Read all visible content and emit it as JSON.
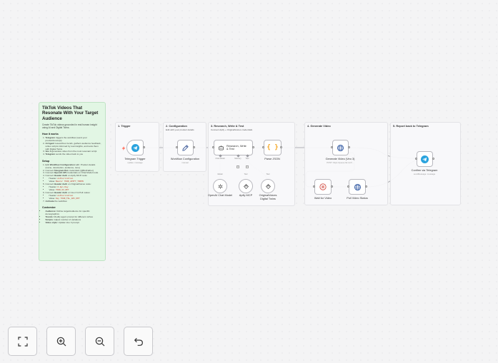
{
  "sticky": {
    "title": "TikTok Videos That Resonate With Your Target Audience",
    "description": "Create TikTok videos grounded in real human insight using AI and Digital Twins.",
    "how_heading": "How it works",
    "how_steps": [
      [
        "Telegram",
        " triggers the workflow (send your product/concept)"
      ],
      [
        "AI Agent",
        " researches trends, gathers audience feedback, writes scripts informed by real insights, and tests them with Digital Twins"
      ],
      [
        "Veo 3",
        " generates video from the most resonant script"
      ],
      [
        "Telegram",
        " sends the video back to you"
      ]
    ],
    "setup_heading": "Setup",
    "setup_steps": [
      {
        "pre": "Edit ",
        "bold": "Workflow Configuration",
        "post": " with: Product details (name, description, audience, tone)",
        "sub": []
      },
      {
        "pre": "Connect ",
        "bold": "Telegram Bot",
        "post": " credentials (@BotFather)",
        "sub": []
      },
      {
        "pre": "Connect ",
        "bold": "OpenAI API",
        "post": " credentials on Chat Model node",
        "sub": []
      },
      {
        "pre": "Connect ",
        "bold": "Header Auth",
        "post": " on Apify MCP node:",
        "sub": [
          [
            "Header: ",
            "Authorization"
          ],
          [
            "Value: ",
            "Bearer YOUR_APIFY_TOKEN"
          ]
        ]
      },
      {
        "pre": "Connect ",
        "bold": "Header Auth",
        "post": " on OriginalVoices node:",
        "sub": [
          [
            "Header: ",
            "X-Api-Key"
          ],
          [
            "Value: ",
            "YOUR_OV_KEY"
          ]
        ]
      },
      {
        "pre": "Connect ",
        "bold": "Header Auth",
        "post": " on Veo 3 & Poll nodes:",
        "sub": [
          [
            "Header: ",
            "Authorization"
          ],
          [
            "Value: ",
            "Key YOUR_FAL_API_KEY"
          ]
        ]
      },
      {
        "pre": "",
        "bold": "Activate",
        "post": " the workflow",
        "sub": []
      }
    ],
    "custom_heading": "Customize",
    "custom_items": [
      [
        "Audience:",
        " Refine targetAudience for specific demographics"
      ],
      [
        "Trends:",
        " Modify agent prompt for different niches"
      ],
      [
        "Scripts:",
        " Adjust number of variations"
      ],
      [
        "Video style:",
        " Update Veo 3 prompt"
      ]
    ]
  },
  "groups": {
    "trigger": {
      "title": "1. Trigger",
      "sub": ""
    },
    "config": {
      "title": "2. Configuration",
      "sub": "Edit with your product details"
    },
    "research": {
      "title": "3. Research, Write & Test",
      "sub": "Connect Apify + OriginalVoices credentials"
    },
    "video": {
      "title": "4. Generate Video",
      "sub": ""
    },
    "report": {
      "title": "5. Report back to Telegram",
      "sub": ""
    }
  },
  "nodes": {
    "telegram_trigger": {
      "label": "Telegram Trigger",
      "sub": "update: message"
    },
    "workflow_config": {
      "label": "Workflow Configuration",
      "sub": "manual"
    },
    "agent": {
      "label": "Research, Write & Test"
    },
    "parse_json": {
      "label": "Parse JSON"
    },
    "generate_video": {
      "label": "Generate Video (Veo 3)",
      "sub": "POST: https://queue.fal.run/f..."
    },
    "confirm_telegram": {
      "label": "Confirm via Telegram",
      "sub": "sendMessage: message"
    },
    "wait_video": {
      "label": "Wait for Video"
    },
    "poll_video": {
      "label": "Poll Video Status"
    },
    "openai_model": {
      "label": "OpenAI Chat Model"
    },
    "apify_mcp": {
      "label": "Apify MCP"
    },
    "originalvoices": {
      "label": "OriginalVoices Digital Twins"
    }
  },
  "ports": {
    "chat_model": "Chat Model",
    "chat_model_short": "Model",
    "memory": "Memory",
    "tool": "Tool",
    "tool2": "Tool"
  },
  "icons": {
    "telegram": "telegram-icon",
    "pencil": "pencil-icon",
    "robot": "robot-icon",
    "braces": "braces-icon",
    "globe": "globe-icon",
    "pause": "pause-icon",
    "openai": "openai-icon",
    "mcp": "mcp-icon"
  },
  "colors": {
    "telegram": "#2aa3de",
    "pencil": "#3d5a98",
    "braces": "#f5a623",
    "globe": "#2d55a0",
    "pause": "#d0453a",
    "sticky": "#e2f6e4",
    "trigger_bolt": "#ff6d5a"
  }
}
